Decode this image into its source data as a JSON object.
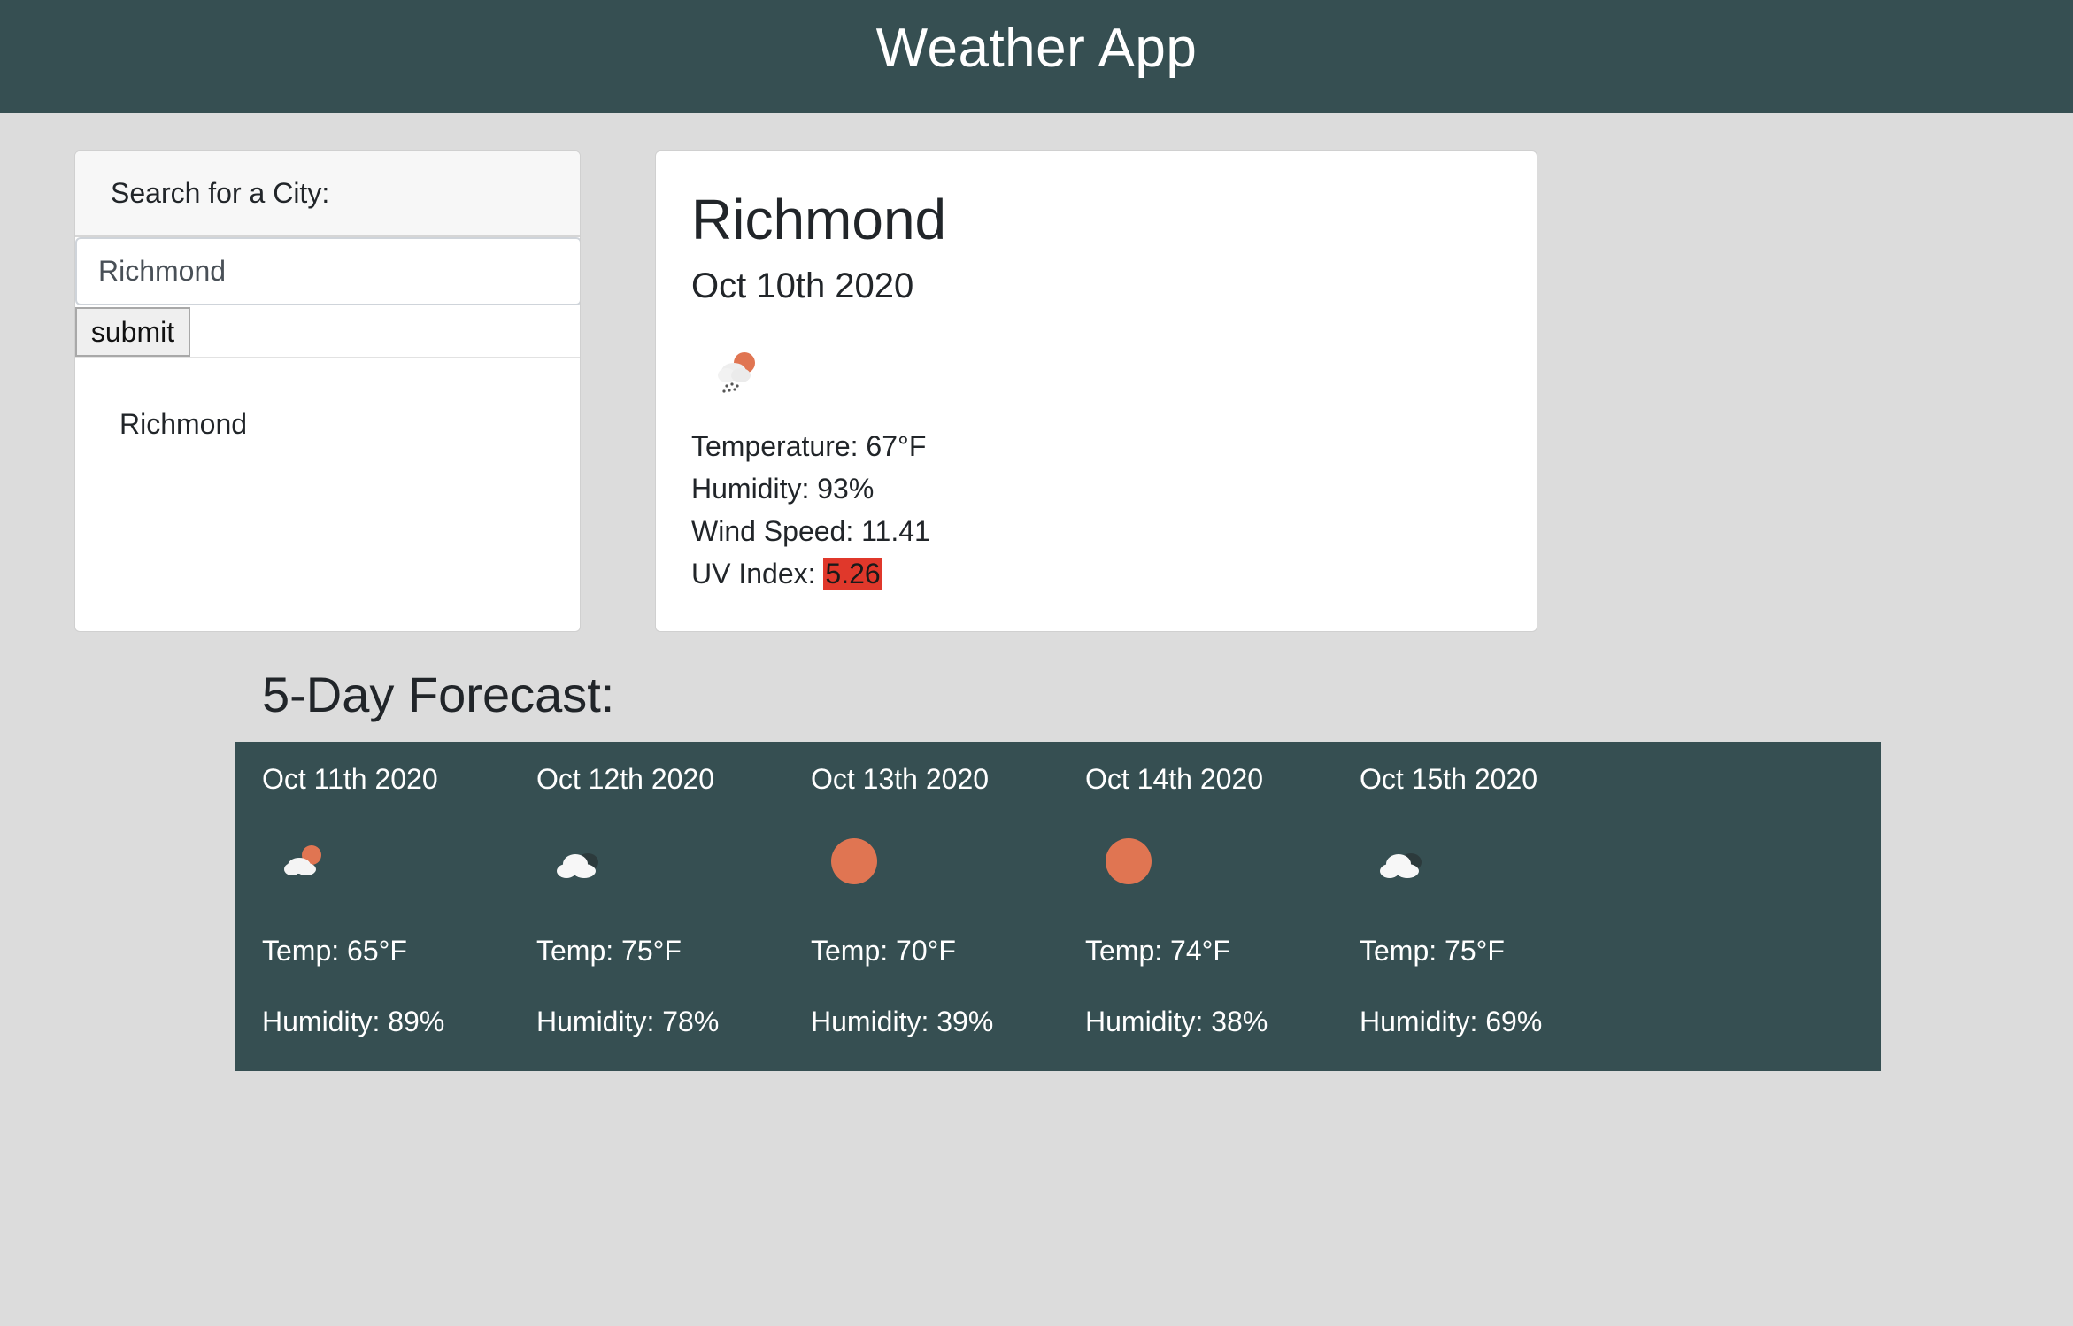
{
  "header": {
    "title": "Weather App"
  },
  "search": {
    "label": "Search for a City:",
    "input_value": "Richmond",
    "submit_label": "submit",
    "history": [
      "Richmond"
    ]
  },
  "current": {
    "city": "Richmond",
    "date": "Oct 10th 2020",
    "icon": "rain-cloud-sun-icon",
    "temperature": "Temperature: 67°F",
    "humidity": "Humidity: 93%",
    "wind_speed": "Wind Speed: 11.41",
    "uv_label": "UV Index: ",
    "uv_value": "5.26",
    "uv_color": "#e0382b"
  },
  "forecast": {
    "title": "5-Day Forecast:",
    "days": [
      {
        "date": "Oct 11th 2020",
        "icon": "cloud-sun-icon",
        "temp": "Temp: 65°F",
        "humidity": "Humidity: 89%"
      },
      {
        "date": "Oct 12th 2020",
        "icon": "cloud-icon",
        "temp": "Temp: 75°F",
        "humidity": "Humidity: 78%"
      },
      {
        "date": "Oct 13th 2020",
        "icon": "sun-icon",
        "temp": "Temp: 70°F",
        "humidity": "Humidity: 39%"
      },
      {
        "date": "Oct 14th 2020",
        "icon": "sun-icon",
        "temp": "Temp: 74°F",
        "humidity": "Humidity: 38%"
      },
      {
        "date": "Oct 15th 2020",
        "icon": "cloud-icon",
        "temp": "Temp: 75°F",
        "humidity": "Humidity: 69%"
      }
    ]
  },
  "colors": {
    "header_bg": "#364f52",
    "page_bg": "#dcdcdc",
    "sun": "#e07552"
  }
}
